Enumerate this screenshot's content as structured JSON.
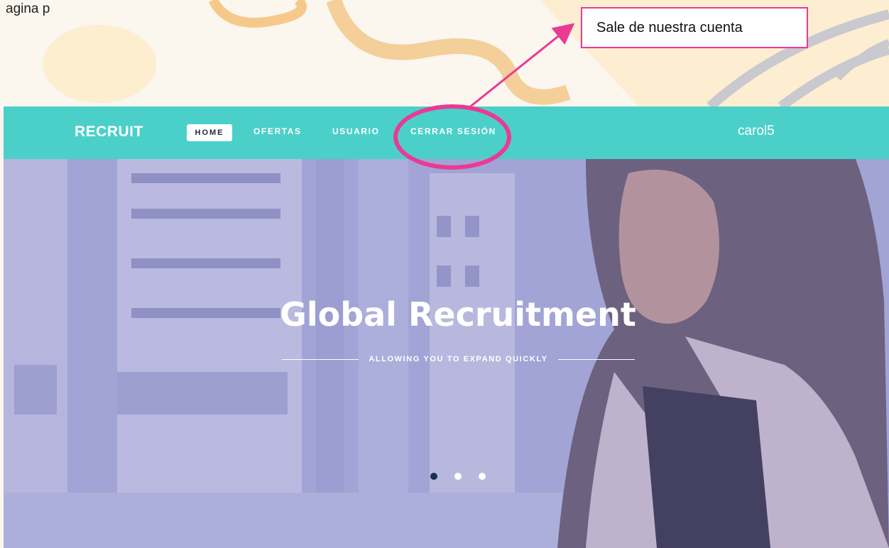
{
  "caption": {
    "text": "agina p"
  },
  "callout": {
    "text": "Sale de nuestra cuenta"
  },
  "site": {
    "brand": "RECRUIT",
    "nav": {
      "home": "HOME",
      "ofertas": "OFERTAS",
      "usuario": "USUARIO",
      "cerrar_sesion": "CERRAR SESIÓN"
    },
    "username": "carol5",
    "hero": {
      "title": "Global Recruitment",
      "subtitle": "ALLOWING YOU TO EXPAND QUICKLY",
      "slide_count": 3,
      "active_slide": 1
    }
  },
  "colors": {
    "navbar": "#4bd0c9",
    "hero_overlay": "#9ea0d8",
    "annotation": "#ea3a93",
    "active_dot": "#1e2f54"
  }
}
